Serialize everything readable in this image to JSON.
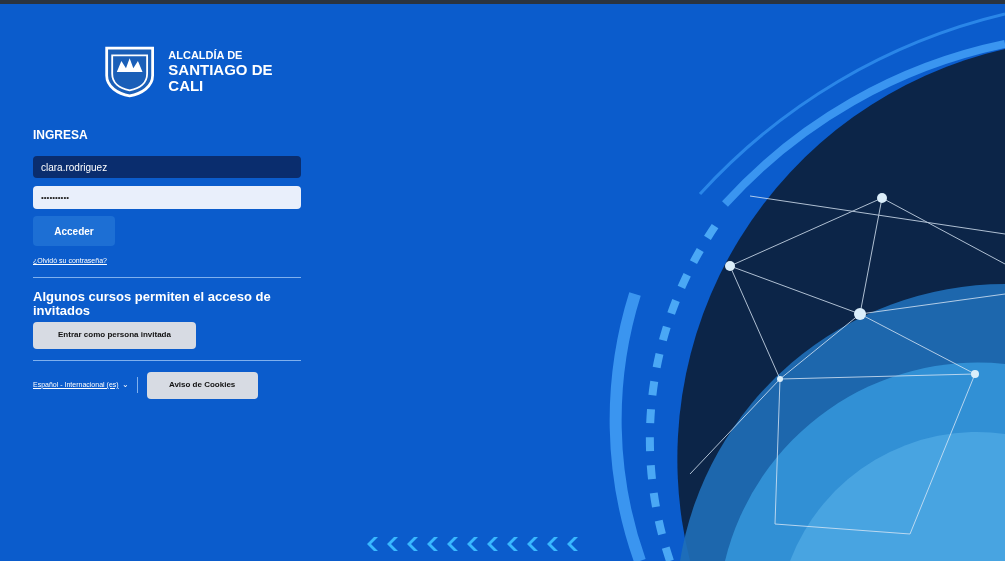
{
  "brand": {
    "line_1": "ALCALDÍA DE",
    "line_2": "SANTIAGO DE CALI"
  },
  "login": {
    "heading": "INGRESA",
    "username": {
      "value": "clara.rodriguez"
    },
    "password": {
      "value": "••••••••••"
    },
    "submit": "Acceder",
    "forgot_link": "¿Olvidó su contraseña?"
  },
  "guest": {
    "heading": "Algunos cursos permiten el acceso de invitados",
    "button": "Entrar como persona invitada"
  },
  "footer": {
    "language": "Español - Internacional (es)",
    "language_caret": "⌄",
    "cookies_button": "Aviso de Cookies"
  }
}
